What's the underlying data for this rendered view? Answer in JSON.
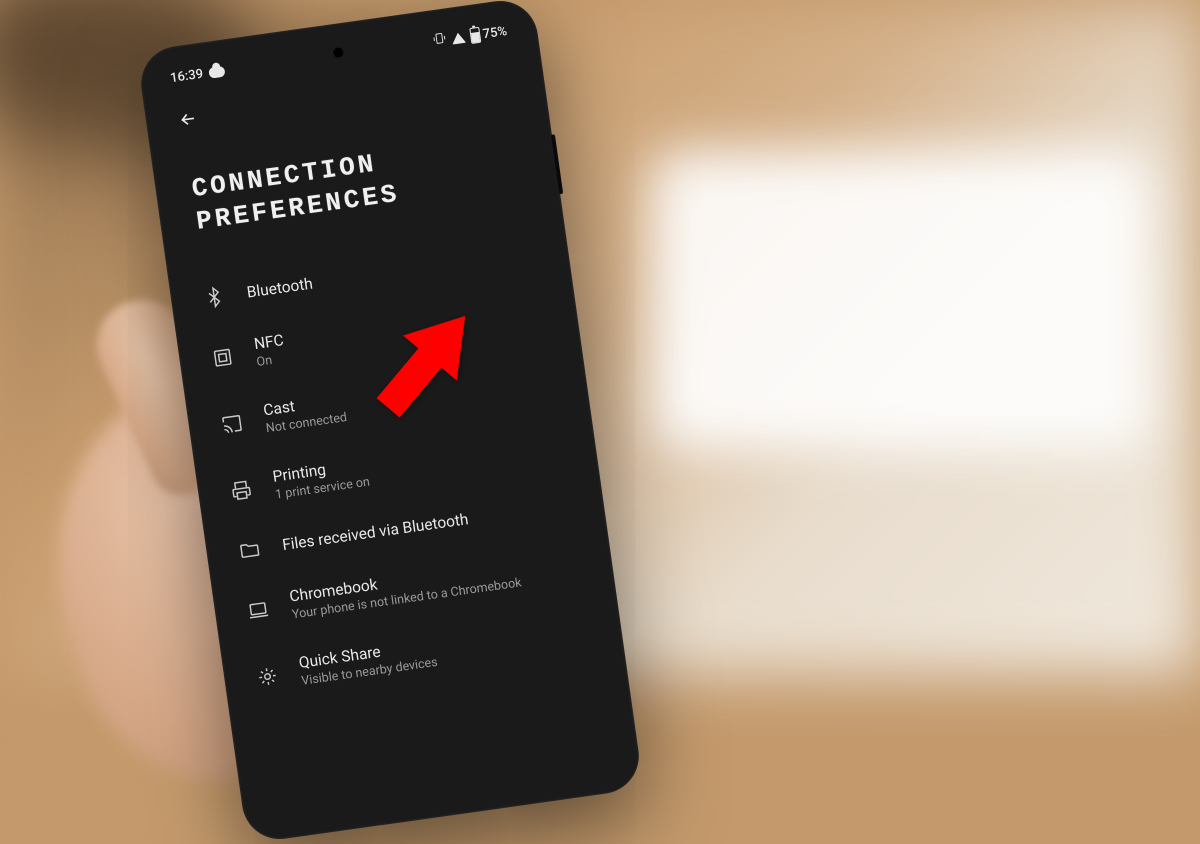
{
  "status_bar": {
    "time": "16:39",
    "battery": "75%"
  },
  "page": {
    "title_line1": "CONNECTION",
    "title_line2": "PREFERENCES"
  },
  "items": [
    {
      "label": "Bluetooth",
      "sublabel": ""
    },
    {
      "label": "NFC",
      "sublabel": "On"
    },
    {
      "label": "Cast",
      "sublabel": "Not connected"
    },
    {
      "label": "Printing",
      "sublabel": "1 print service on"
    },
    {
      "label": "Files received via Bluetooth",
      "sublabel": ""
    },
    {
      "label": "Chromebook",
      "sublabel": "Your phone is not linked to a Chromebook"
    },
    {
      "label": "Quick Share",
      "sublabel": "Visible to nearby devices"
    }
  ],
  "annotation": {
    "arrow_color": "#ff0000"
  }
}
